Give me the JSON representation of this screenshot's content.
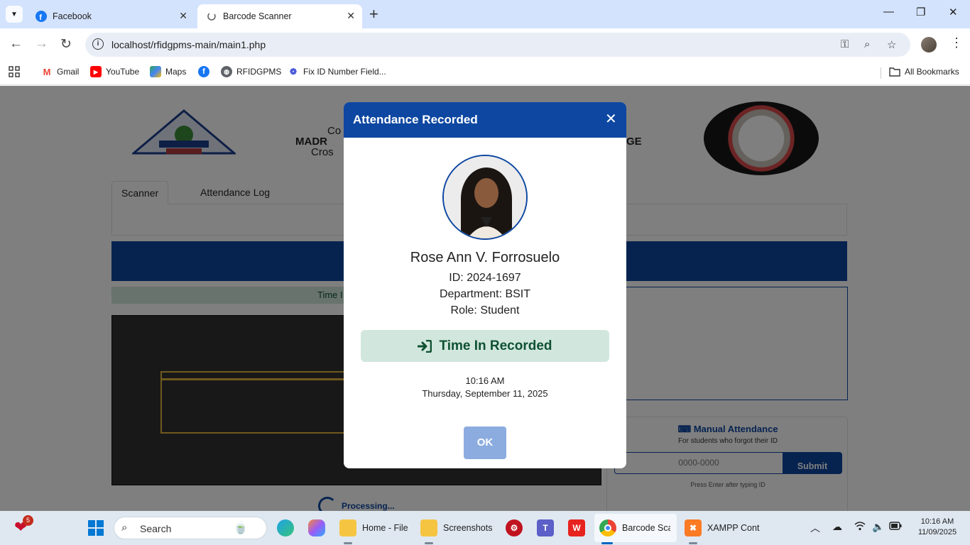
{
  "browser": {
    "tabs": [
      {
        "title": "Facebook",
        "icon": "facebook-icon"
      },
      {
        "title": "Barcode Scanner",
        "icon": "page-icon",
        "active": true
      }
    ],
    "url": "localhost/rfidgpms-main/main1.php",
    "bookmarks": [
      {
        "label": "Gmail",
        "icon": "gmail-icon"
      },
      {
        "label": "YouTube",
        "icon": "youtube-icon"
      },
      {
        "label": "Maps",
        "icon": "maps-icon"
      },
      {
        "label": "",
        "icon": "facebook-icon"
      },
      {
        "label": "RFIDGPMS",
        "icon": "globe-icon"
      },
      {
        "label": "Fix ID Number Field...",
        "icon": "link-icon"
      }
    ],
    "all_bookmarks": "All Bookmarks"
  },
  "page": {
    "school_text_lines": [
      "Co",
      "MADR",
      "Cros"
    ],
    "school_text_right": "GE",
    "tabs": [
      "Scanner",
      "Attendance Log"
    ],
    "time_strip_label": "Time I",
    "processing": "Processing...",
    "manual": {
      "title": "Manual Attendance",
      "subtitle": "For students who forgot their ID",
      "placeholder": "0000-0000",
      "submit": "Submit",
      "hint": "Press Enter after typing ID"
    }
  },
  "modal": {
    "title": "Attendance Recorded",
    "name": "Rose Ann V. Forrosuelo",
    "id_line": "ID: 2024-1697",
    "department_line": "Department: BSIT",
    "role_line": "Role: Student",
    "status": "Time In Recorded",
    "time": "10:16 AM",
    "date": "Thursday, September 11, 2025",
    "ok": "OK"
  },
  "taskbar": {
    "notification_count": "5",
    "search_label": "Search",
    "items": [
      {
        "label": "Home - File"
      },
      {
        "label": "Screenshots"
      },
      {
        "label": "Barcode Scar"
      },
      {
        "label": "XAMPP Cont"
      }
    ],
    "clock_time": "10:16 AM",
    "clock_date": "11/09/2025"
  },
  "colors": {
    "primary": "#0d47a1",
    "success_bg": "#d1e7dd",
    "success_text": "#0f5132",
    "ok_button": "#8cace0"
  }
}
